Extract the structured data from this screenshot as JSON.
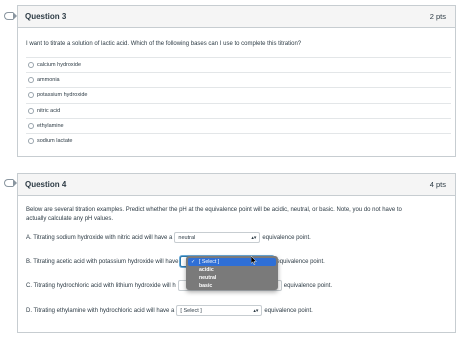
{
  "q3": {
    "title": "Question 3",
    "points": "2 pts",
    "prompt": "I want to titrate a solution of lactic acid.  Which of the following bases can I use to complete this titration?",
    "answers": [
      "calcium hydroxide",
      "ammonia",
      "potassium hydroxide",
      "nitric acid",
      "ethylamine",
      "sodium lactate"
    ]
  },
  "q4": {
    "title": "Question 4",
    "points": "4 pts",
    "prompt_line1": "Below are several titration examples.  Predict whether the pH at the equivalence point will be acidic, neutral, or basic.  Note, you do not have to",
    "prompt_line2": "actually calculate any pH values.",
    "rows": [
      {
        "before": "A. Titrating sodium hydroxide with nitric acid will have a",
        "select": "neutral",
        "after": "equivalence point."
      },
      {
        "before": "B. Titrating acetic acid with potassium hydroxide will have",
        "select": "[ Select ]",
        "after": "equivalence point."
      },
      {
        "before": "C. Titrating hydrochloric acid with lithium hydroxide will h",
        "select": "",
        "after": "equivalence point."
      },
      {
        "before": "D. Titrating ethylamine with hydrochloric acid will have a",
        "select": "[ Select ]",
        "after": "equivalence point."
      }
    ],
    "dropdown_options": [
      "[ Select ]",
      "acidic",
      "neutral",
      "basic"
    ],
    "dropdown_selected": "[ Select ]"
  },
  "icons": {
    "flag": "flag-outline-icon",
    "radio": "radio-empty-icon",
    "caret": "select-caret-icon",
    "check": "checkmark-icon",
    "cursor": "mouse-pointer-icon"
  },
  "colors": {
    "header_bg": "#f5f5f5",
    "border": "#c7cdd1",
    "text": "#2d3b45",
    "dropdown_bg": "#7a7a7a",
    "dropdown_highlight": "#2f6fd6",
    "focus_ring": "#2a7ab0"
  }
}
